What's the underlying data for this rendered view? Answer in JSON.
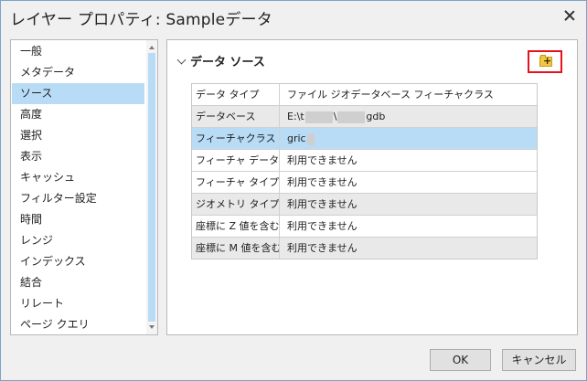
{
  "window": {
    "title": "レイヤー プロパティ: Sampleデータ"
  },
  "sidebar": {
    "items": [
      {
        "label": "一般"
      },
      {
        "label": "メタデータ"
      },
      {
        "label": "ソース",
        "selected": true
      },
      {
        "label": "高度"
      },
      {
        "label": "選択"
      },
      {
        "label": "表示"
      },
      {
        "label": "キャッシュ"
      },
      {
        "label": "フィルター設定"
      },
      {
        "label": "時間"
      },
      {
        "label": "レンジ"
      },
      {
        "label": "インデックス"
      },
      {
        "label": "結合"
      },
      {
        "label": "リレート"
      },
      {
        "label": "ページ クエリ"
      }
    ]
  },
  "main": {
    "section_title": "データ ソース",
    "rows": [
      {
        "label": "データ タイプ",
        "value": "ファイル ジオデータベース フィーチャクラス"
      },
      {
        "label": "データベース",
        "value_parts": [
          "E:\\t",
          "\\",
          "gdb"
        ]
      },
      {
        "label": "フィーチャクラス",
        "value": "gric",
        "selected": true
      },
      {
        "label": "フィーチャ データセット",
        "value": "利用できません"
      },
      {
        "label": "フィーチャ タイプ",
        "value": "利用できません"
      },
      {
        "label": "ジオメトリ タイプ",
        "value": "利用できません"
      },
      {
        "label": "座標に Z 値を含む",
        "value": "利用できません"
      },
      {
        "label": "座標に M 値を含む",
        "value": "利用できません"
      }
    ]
  },
  "footer": {
    "ok_label": "OK",
    "cancel_label": "キャンセル"
  },
  "colors": {
    "selection": "#b9dcf6",
    "highlight_border": "#e8121a",
    "folder_icon": "#f2c744"
  }
}
